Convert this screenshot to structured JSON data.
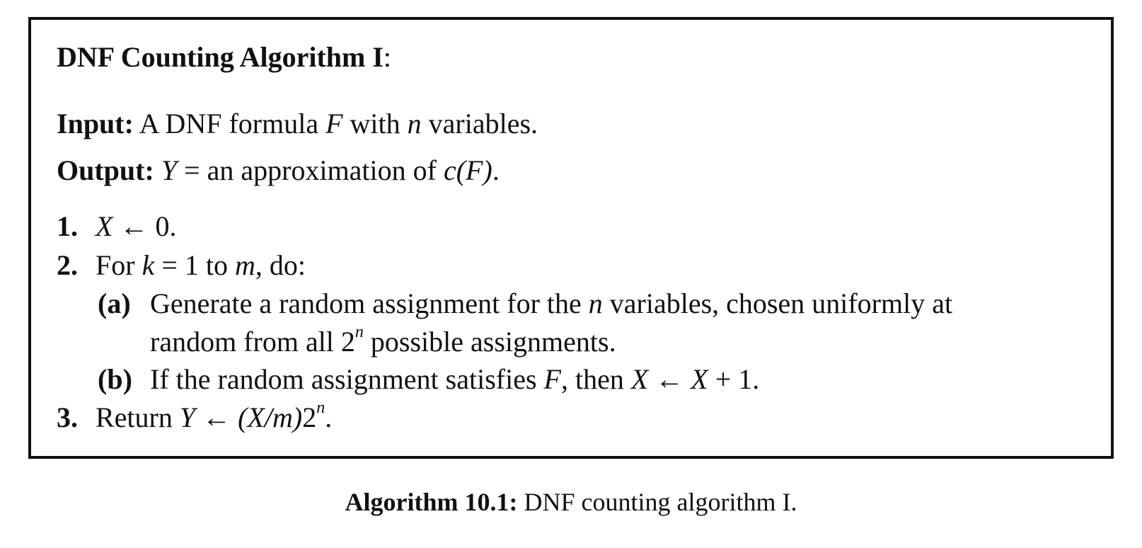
{
  "algorithm": {
    "title": "DNF Counting Algorithm I",
    "title_colon": ":",
    "input": {
      "label": "Input:",
      "text_1": "A DNF formula ",
      "var_f": "F",
      "text_2": " with ",
      "var_n": "n",
      "text_3": " variables."
    },
    "output": {
      "label": "Output:",
      "var_y": "Y",
      "text_1": " = an approximation of ",
      "expr": "c(F)",
      "text_2": "."
    },
    "steps": [
      {
        "marker": "1.",
        "var_x": "X",
        "text": " ← 0."
      },
      {
        "marker": "2.",
        "text_1": "For ",
        "var_k": "k",
        "text_2": " = 1 to ",
        "var_m": "m",
        "text_3": ", do:",
        "substeps": [
          {
            "marker": "(a)",
            "text_1": "Generate a random assignment for the ",
            "var_n": "n",
            "text_2": " variables, chosen uniformly at",
            "cont_1": "random from all 2",
            "sup": "n",
            "cont_2": " possible assignments."
          },
          {
            "marker": "(b)",
            "text_1": "If the random assignment satisfies ",
            "var_f": "F",
            "text_2": ", then ",
            "var_x1": "X",
            "text_3": " ← ",
            "var_x2": "X",
            "text_4": " + 1."
          }
        ]
      },
      {
        "marker": "3.",
        "text_1": "Return ",
        "var_y": "Y",
        "text_2": " ← ",
        "expr": "(X/m)",
        "text_3": "2",
        "sup": "n",
        "text_4": "."
      }
    ]
  },
  "caption": {
    "label": "Algorithm 10.1:",
    "text": " DNF counting algorithm I."
  }
}
